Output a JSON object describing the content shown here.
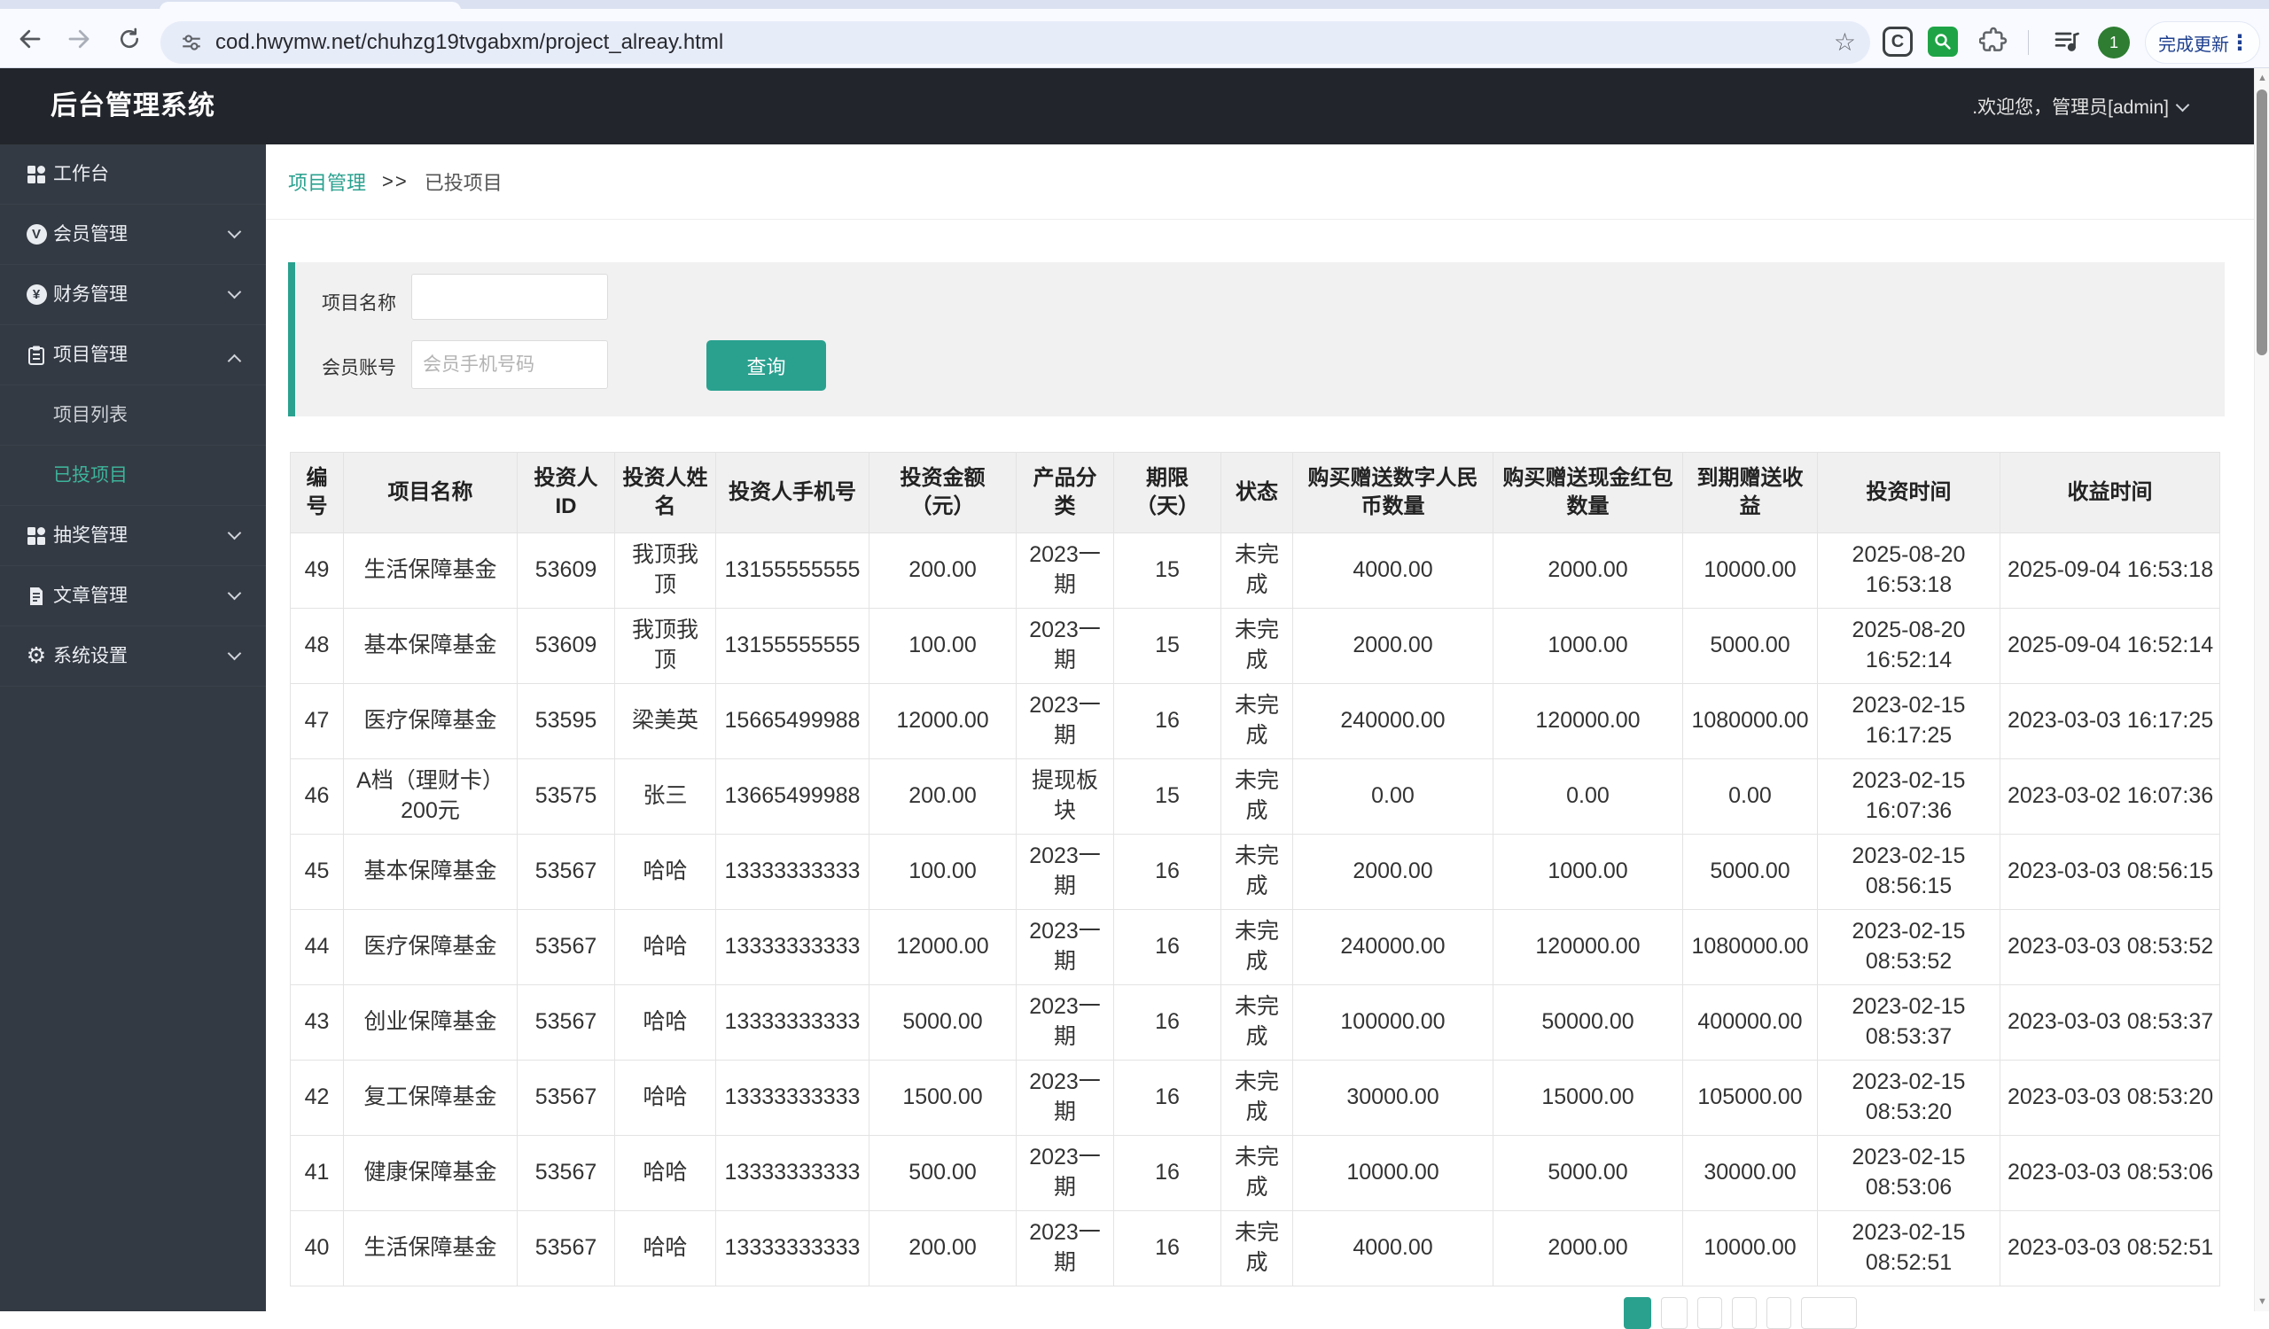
{
  "browser": {
    "url": "cod.hwymw.net/chuhzg19tvgabxm/project_alreay.html",
    "update_button_label": "完成更新",
    "profile_initial": "1"
  },
  "header": {
    "title": "后台管理系统",
    "welcome": ".欢迎您，管理员[admin]"
  },
  "sidebar": {
    "items": [
      {
        "label": "工作台"
      },
      {
        "label": "会员管理"
      },
      {
        "label": "财务管理"
      },
      {
        "label": "项目管理",
        "children": [
          {
            "label": "项目列表",
            "active": false
          },
          {
            "label": "已投项目",
            "active": true
          }
        ]
      },
      {
        "label": "抽奖管理"
      },
      {
        "label": "文章管理"
      },
      {
        "label": "系统设置"
      }
    ]
  },
  "breadcrumb": {
    "parent": "项目管理",
    "separator": ">>",
    "current": "已投项目"
  },
  "filter": {
    "fields": [
      {
        "label": "项目名称",
        "value": "",
        "placeholder": ""
      },
      {
        "label": "会员账号",
        "value": "",
        "placeholder": "会员手机号码"
      }
    ],
    "search_button": "查询"
  },
  "table": {
    "columns": [
      "编号",
      "项目名称",
      "投资人ID",
      "投资人姓名",
      "投资人手机号",
      "投资金额（元）",
      "产品分类",
      "期限（天）",
      "状态",
      "购买赠送数字人民币数量",
      "购买赠送现金红包数量",
      "到期赠送收益",
      "投资时间",
      "收益时间"
    ],
    "rows": [
      [
        "49",
        "生活保障基金",
        "53609",
        "我顶我顶",
        "13155555555",
        "200.00",
        "2023一期",
        "15",
        "未完成",
        "4000.00",
        "2000.00",
        "10000.00",
        "2025-08-20 16:53:18",
        "2025-09-04 16:53:18"
      ],
      [
        "48",
        "基本保障基金",
        "53609",
        "我顶我顶",
        "13155555555",
        "100.00",
        "2023一期",
        "15",
        "未完成",
        "2000.00",
        "1000.00",
        "5000.00",
        "2025-08-20 16:52:14",
        "2025-09-04 16:52:14"
      ],
      [
        "47",
        "医疗保障基金",
        "53595",
        "梁美英",
        "15665499988",
        "12000.00",
        "2023一期",
        "16",
        "未完成",
        "240000.00",
        "120000.00",
        "1080000.00",
        "2023-02-15 16:17:25",
        "2023-03-03 16:17:25"
      ],
      [
        "46",
        "A档（理财卡）200元",
        "53575",
        "张三",
        "13665499988",
        "200.00",
        "提现板块",
        "15",
        "未完成",
        "0.00",
        "0.00",
        "0.00",
        "2023-02-15 16:07:36",
        "2023-03-02 16:07:36"
      ],
      [
        "45",
        "基本保障基金",
        "53567",
        "哈哈",
        "13333333333",
        "100.00",
        "2023一期",
        "16",
        "未完成",
        "2000.00",
        "1000.00",
        "5000.00",
        "2023-02-15 08:56:15",
        "2023-03-03 08:56:15"
      ],
      [
        "44",
        "医疗保障基金",
        "53567",
        "哈哈",
        "13333333333",
        "12000.00",
        "2023一期",
        "16",
        "未完成",
        "240000.00",
        "120000.00",
        "1080000.00",
        "2023-02-15 08:53:52",
        "2023-03-03 08:53:52"
      ],
      [
        "43",
        "创业保障基金",
        "53567",
        "哈哈",
        "13333333333",
        "5000.00",
        "2023一期",
        "16",
        "未完成",
        "100000.00",
        "50000.00",
        "400000.00",
        "2023-02-15 08:53:37",
        "2023-03-03 08:53:37"
      ],
      [
        "42",
        "复工保障基金",
        "53567",
        "哈哈",
        "13333333333",
        "1500.00",
        "2023一期",
        "16",
        "未完成",
        "30000.00",
        "15000.00",
        "105000.00",
        "2023-02-15 08:53:20",
        "2023-03-03 08:53:20"
      ],
      [
        "41",
        "健康保障基金",
        "53567",
        "哈哈",
        "13333333333",
        "500.00",
        "2023一期",
        "16",
        "未完成",
        "10000.00",
        "5000.00",
        "30000.00",
        "2023-02-15 08:53:06",
        "2023-03-03 08:53:06"
      ],
      [
        "40",
        "生活保障基金",
        "53567",
        "哈哈",
        "13333333333",
        "200.00",
        "2023一期",
        "16",
        "未完成",
        "4000.00",
        "2000.00",
        "10000.00",
        "2023-02-15 08:52:51",
        "2023-03-03 08:52:51"
      ]
    ]
  },
  "icons": {
    "member_v": "V",
    "finance_yen": "¥",
    "gear": "⚙",
    "extension_c": "C",
    "star": "☆",
    "kebab": "⋮",
    "scroll_up": "▲",
    "scroll_down": "▼"
  },
  "colors": {
    "accent": "#2aa18f",
    "sidebar_active": "#3db39b",
    "header_bg": "#22252b",
    "sidebar_bg": "#343a43"
  }
}
